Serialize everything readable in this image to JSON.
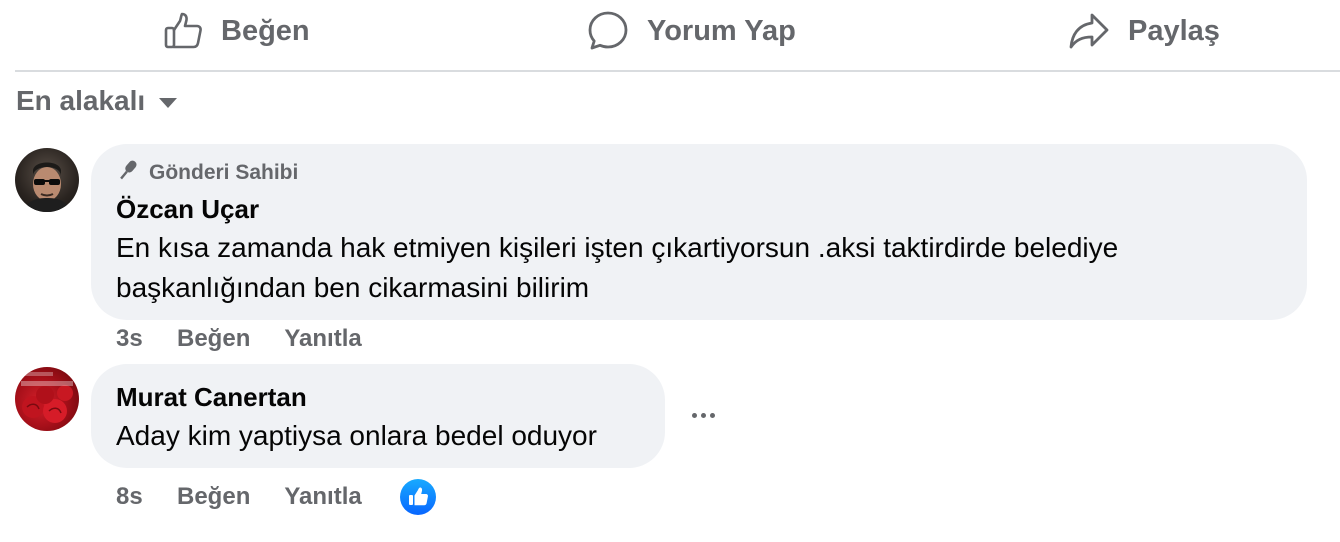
{
  "actions": {
    "like_label": "Beğen",
    "comment_label": "Yorum Yap",
    "share_label": "Paylaş"
  },
  "sort": {
    "label": "En alakalı"
  },
  "comments": [
    {
      "badge": "Gönderi Sahibi",
      "author": "Özcan Uçar",
      "text": "En kısa zamanda hak etmiyen kişileri işten çıkartiyorsun .aksi taktirdirde belediye başkanlığından ben cikarmasini bilirim",
      "time": "3s",
      "like_label": "Beğen",
      "reply_label": "Yanıtla"
    },
    {
      "author": "Murat Canertan",
      "text": "Aday kim yaptiysa onlara bedel oduyor",
      "time": "8s",
      "like_label": "Beğen",
      "reply_label": "Yanıtla",
      "reaction": "like-icon"
    }
  ],
  "colors": {
    "muted": "#65676b",
    "bubble": "#f0f2f5",
    "like_blue": "#0866ff"
  }
}
